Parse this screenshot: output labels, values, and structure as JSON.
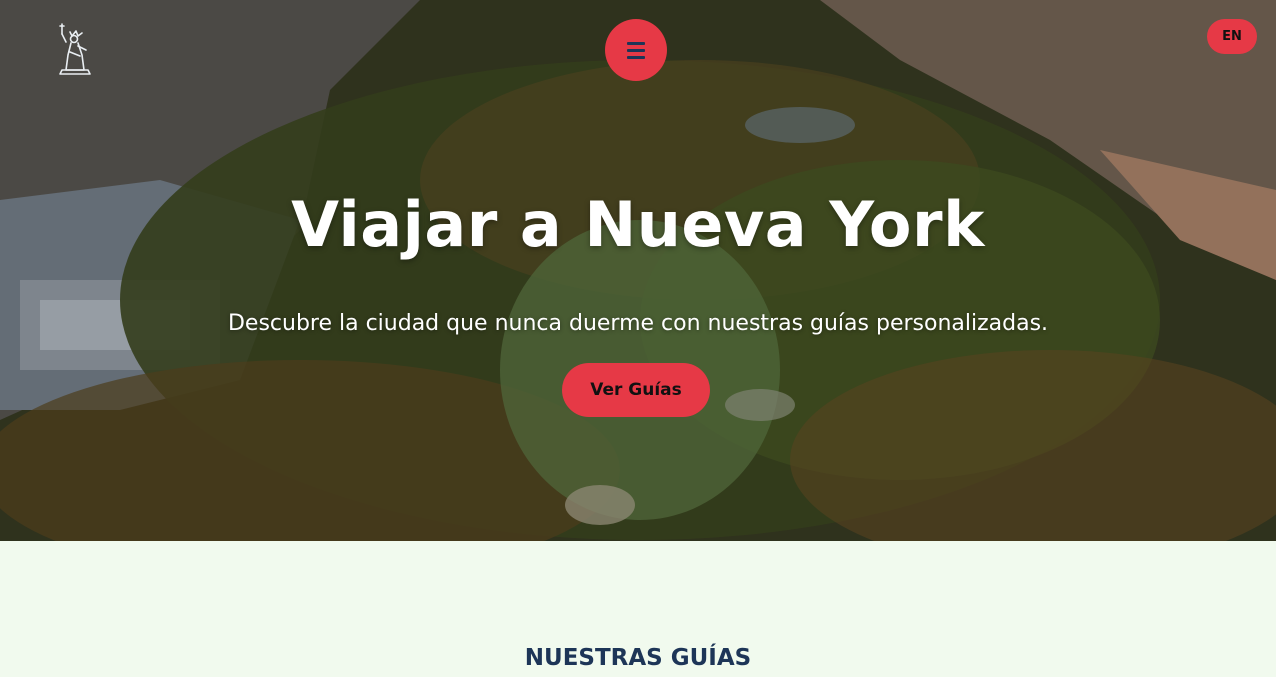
{
  "header": {
    "logo_icon": "statue-of-liberty-icon",
    "menu_icon": "hamburger-menu-icon",
    "lang_label": "EN"
  },
  "hero": {
    "title": "Viajar a Nueva York",
    "subtitle": "Descubre la ciudad que nunca duerme con nuestras guías personalizadas.",
    "cta_label": "Ver Guías"
  },
  "guides": {
    "heading": "NUESTRAS GUÍAS"
  },
  "colors": {
    "accent": "#e63946",
    "navy": "#1d3557",
    "background": "#f1faee"
  }
}
